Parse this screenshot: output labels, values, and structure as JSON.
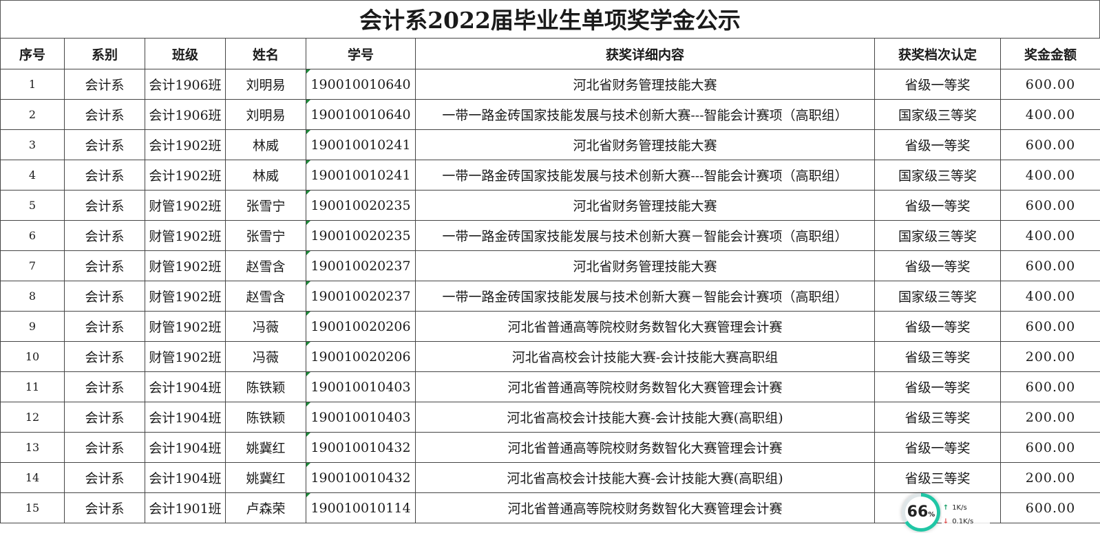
{
  "title": "会计系2022届毕业生单项奖学金公示",
  "headers": [
    "序号",
    "系别",
    "班级",
    "姓名",
    "学号",
    "获奖详细内容",
    "获奖档次认定",
    "奖金金额"
  ],
  "rows": [
    [
      "1",
      "会计系",
      "会计1906班",
      "刘明易",
      "190010010640",
      "河北省财务管理技能大赛",
      "省级一等奖",
      "600.00"
    ],
    [
      "2",
      "会计系",
      "会计1906班",
      "刘明易",
      "190010010640",
      "一带一路金砖国家技能发展与技术创新大赛---智能会计赛项（高职组）",
      "国家级三等奖",
      "400.00"
    ],
    [
      "3",
      "会计系",
      "会计1902班",
      "林威",
      "190010010241",
      "河北省财务管理技能大赛",
      "省级一等奖",
      "600.00"
    ],
    [
      "4",
      "会计系",
      "会计1902班",
      "林威",
      "190010010241",
      "一带一路金砖国家技能发展与技术创新大赛---智能会计赛项（高职组）",
      "国家级三等奖",
      "400.00"
    ],
    [
      "5",
      "会计系",
      "财管1902班",
      "张雪宁",
      "190010020235",
      "河北省财务管理技能大赛",
      "省级一等奖",
      "600.00"
    ],
    [
      "6",
      "会计系",
      "财管1902班",
      "张雪宁",
      "190010020235",
      "一带一路金砖国家技能发展与技术创新大赛－智能会计赛项（高职组）",
      "国家级三等奖",
      "400.00"
    ],
    [
      "7",
      "会计系",
      "财管1902班",
      "赵雪含",
      "190010020237",
      "河北省财务管理技能大赛",
      "省级一等奖",
      "600.00"
    ],
    [
      "8",
      "会计系",
      "财管1902班",
      "赵雪含",
      "190010020237",
      "一带一路金砖国家技能发展与技术创新大赛－智能会计赛项（高职组）",
      "国家级三等奖",
      "400.00"
    ],
    [
      "9",
      "会计系",
      "财管1902班",
      "冯薇",
      "190010020206",
      "河北省普通高等院校财务数智化大赛管理会计赛",
      "省级一等奖",
      "600.00"
    ],
    [
      "10",
      "会计系",
      "财管1902班",
      "冯薇",
      "190010020206",
      "河北省高校会计技能大赛-会计技能大赛高职组",
      "省级三等奖",
      "200.00"
    ],
    [
      "11",
      "会计系",
      "会计1904班",
      "陈铁颖",
      "190010010403",
      "河北省普通高等院校财务数智化大赛管理会计赛",
      "省级一等奖",
      "600.00"
    ],
    [
      "12",
      "会计系",
      "会计1904班",
      "陈铁颖",
      "190010010403",
      "河北省高校会计技能大赛-会计技能大赛(高职组)",
      "省级三等奖",
      "200.00"
    ],
    [
      "13",
      "会计系",
      "会计1904班",
      "姚冀红",
      "190010010432",
      "河北省普通高等院校财务数智化大赛管理会计赛",
      "省级一等奖",
      "600.00"
    ],
    [
      "14",
      "会计系",
      "会计1904班",
      "姚冀红",
      "190010010432",
      "河北省高校会计技能大赛-会计技能大赛(高职组)",
      "省级三等奖",
      "200.00"
    ],
    [
      "15",
      "会计系",
      "会计1901班",
      "卢森荣",
      "190010010114",
      "河北省普通高等院校财务数智化大赛管理会计赛",
      "",
      "600.00"
    ]
  ],
  "widget": {
    "percent": "66",
    "percent_unit": "%",
    "ring_fill_percent": 66,
    "ring_color": "#20c6a5",
    "up_speed": "1K/s",
    "down_speed": "0.1K/s",
    "up_icon": "arrow-up-icon",
    "down_icon": "arrow-down-icon"
  }
}
